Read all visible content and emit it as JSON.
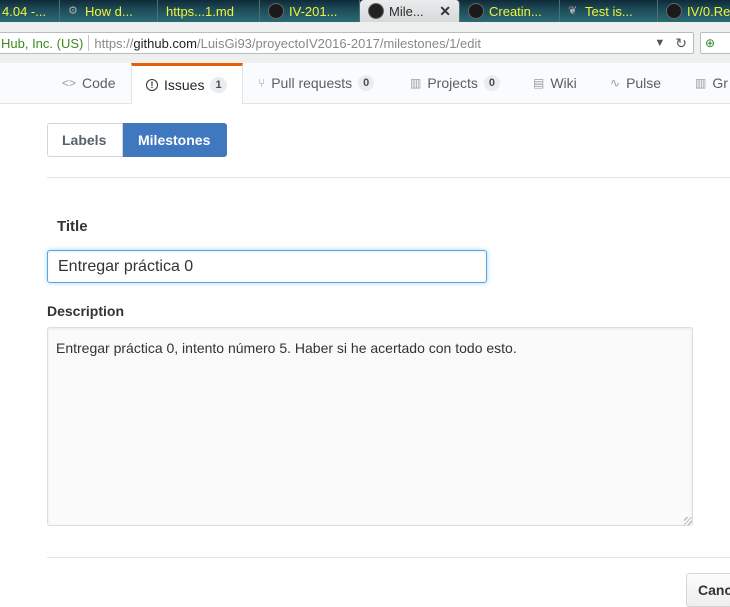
{
  "browser": {
    "tabs": [
      {
        "label": "4.04 -...",
        "icon": "ubuntu-icon"
      },
      {
        "label": "How d...",
        "icon": "stackexchange-icon"
      },
      {
        "label": "https...1.md",
        "icon": "none"
      },
      {
        "label": "IV-201...",
        "icon": "github-icon"
      },
      {
        "label": "Mile...",
        "icon": "github-icon",
        "close": "✕"
      },
      {
        "label": "Creatin...",
        "icon": "github-icon"
      },
      {
        "label": "Test is...",
        "icon": "leaf-icon"
      },
      {
        "label": "IV/0.Re",
        "icon": "github-icon"
      }
    ],
    "site_identity": "Hub, Inc. (US)",
    "url_prefix": "https://",
    "url_host": "github.com",
    "url_path": "/LuisGi93/proyectoIV2016-2017/milestones/1/edit",
    "search_glyph": "⊕"
  },
  "repo_nav": {
    "items": [
      {
        "label": "Code",
        "icon": "<>"
      },
      {
        "label": "Issues",
        "icon": "!",
        "count": "1"
      },
      {
        "label": "Pull requests",
        "icon": "⑂",
        "count": "0"
      },
      {
        "label": "Projects",
        "icon": "▥",
        "count": "0"
      },
      {
        "label": "Wiki",
        "icon": "▤"
      },
      {
        "label": "Pulse",
        "icon": "∿"
      },
      {
        "label": "Gr",
        "icon": "▥"
      }
    ]
  },
  "subnav": {
    "labels": "Labels",
    "milestones": "Milestones"
  },
  "form": {
    "title_label": "Title",
    "title_value": "Entregar práctica 0",
    "description_label": "Description",
    "description_value": "Entregar práctica 0, intento número 5. Haber si he acertado con todo esto.",
    "cancel_label": "Cancel"
  },
  "colors": {
    "accent": "#4078c0",
    "selected_tab_border": "#e36209",
    "focus_border": "#51a7e8"
  }
}
